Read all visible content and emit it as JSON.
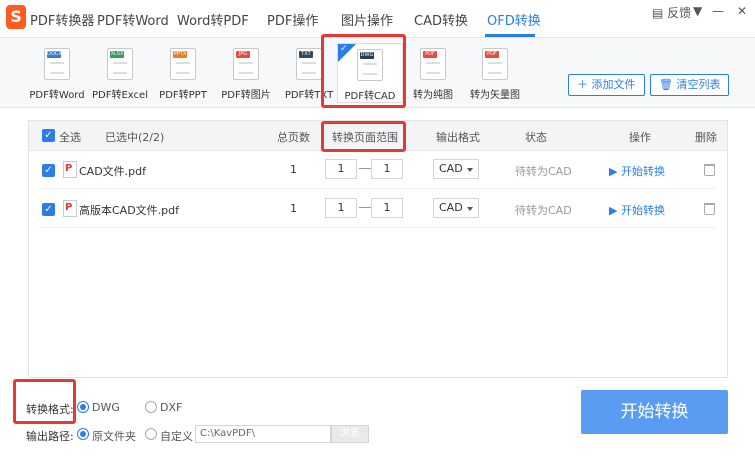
{
  "nav": {
    "app_title": "PDF转换器",
    "items": [
      "PDF转Word",
      "Word转PDF",
      "PDF操作",
      "图片操作",
      "CAD转换",
      "OFD转换"
    ],
    "active_index": 5,
    "feedback": "反馈",
    "window_min": "—",
    "window_close": "✕",
    "window_menu": "▼"
  },
  "tools": [
    {
      "label": "PDF转Word",
      "tag": "DOCX",
      "color": "#3a7bd5"
    },
    {
      "label": "PDF转Excel",
      "tag": "XLSX",
      "color": "#2e9e5b"
    },
    {
      "label": "PDF转PPT",
      "tag": "PPTX",
      "color": "#e67e22"
    },
    {
      "label": "PDF转图片",
      "tag": "JPG",
      "color": "#e74c3c"
    },
    {
      "label": "PDF转TXT",
      "tag": "TXT",
      "color": "#34495e"
    },
    {
      "label": "PDF转CAD",
      "tag": "DWG",
      "color": "#2c3e50"
    },
    {
      "label": "转为纯图",
      "tag": "PDF",
      "color": "#e74c3c"
    },
    {
      "label": "转为矢量图",
      "tag": "PDF",
      "color": "#e74c3c"
    }
  ],
  "toolbar_buttons": {
    "add_file": "添加文件",
    "clear_list": "清空列表"
  },
  "table": {
    "select_all": "全选",
    "selected_count": "已选中(2/2)",
    "columns": {
      "pages": "总页数",
      "range": "转换页面范围",
      "format": "输出格式",
      "status": "状态",
      "action": "操作",
      "delete": "删除"
    },
    "rows": [
      {
        "name": "CAD文件.pdf",
        "pages": "1",
        "from": "1",
        "to": "1",
        "format": "CAD",
        "status": "待转为CAD",
        "action": "开始转换"
      },
      {
        "name": "高版本CAD文件.pdf",
        "pages": "1",
        "from": "1",
        "to": "1",
        "format": "CAD",
        "status": "待转为CAD",
        "action": "开始转换"
      }
    ]
  },
  "options": {
    "format_label": "转换格式:",
    "format_opt1": "DWG",
    "format_opt2": "DXF",
    "path_label": "输出路径:",
    "path_opt1": "原文件夹",
    "path_opt2": "自定义",
    "path_value": "C:\\KavPDF\\",
    "browse": "浏览"
  },
  "start_button": "开始转换",
  "colors": {
    "accent": "#2b7de9",
    "highlight": "#e53935"
  }
}
